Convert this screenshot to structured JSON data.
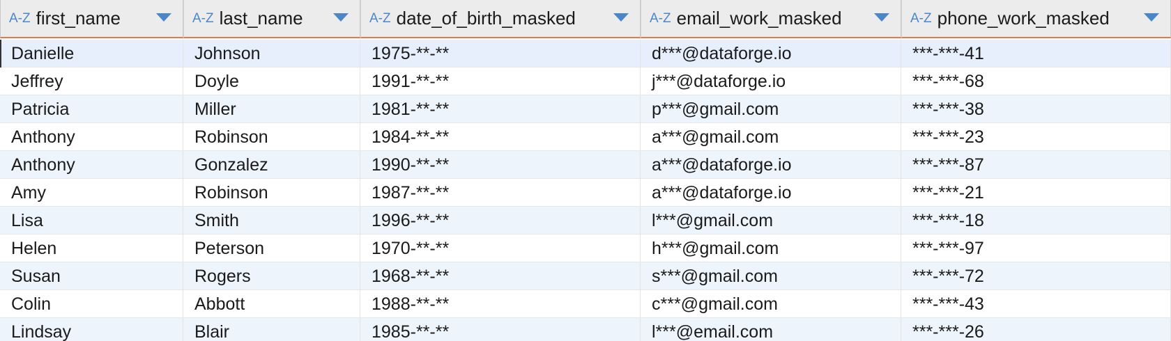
{
  "table": {
    "columns": [
      {
        "type_icon": "A-Z",
        "label": "first_name"
      },
      {
        "type_icon": "A-Z",
        "label": "last_name"
      },
      {
        "type_icon": "A-Z",
        "label": "date_of_birth_masked"
      },
      {
        "type_icon": "A-Z",
        "label": "email_work_masked"
      },
      {
        "type_icon": "A-Z",
        "label": "phone_work_masked"
      }
    ],
    "rows": [
      [
        "Danielle",
        "Johnson",
        "1975-**-**",
        "d***@dataforge.io",
        "***-***-41"
      ],
      [
        "Jeffrey",
        "Doyle",
        "1991-**-**",
        "j***@dataforge.io",
        "***-***-68"
      ],
      [
        "Patricia",
        "Miller",
        "1981-**-**",
        "p***@gmail.com",
        "***-***-38"
      ],
      [
        "Anthony",
        "Robinson",
        "1984-**-**",
        "a***@gmail.com",
        "***-***-23"
      ],
      [
        "Anthony",
        "Gonzalez",
        "1990-**-**",
        "a***@dataforge.io",
        "***-***-87"
      ],
      [
        "Amy",
        "Robinson",
        "1987-**-**",
        "a***@dataforge.io",
        "***-***-21"
      ],
      [
        "Lisa",
        "Smith",
        "1996-**-**",
        "l***@gmail.com",
        "***-***-18"
      ],
      [
        "Helen",
        "Peterson",
        "1970-**-**",
        "h***@gmail.com",
        "***-***-97"
      ],
      [
        "Susan",
        "Rogers",
        "1968-**-**",
        "s***@gmail.com",
        "***-***-72"
      ],
      [
        "Colin",
        "Abbott",
        "1988-**-**",
        "c***@gmail.com",
        "***-***-43"
      ],
      [
        "Lindsay",
        "Blair",
        "1985-**-**",
        "l***@email.com",
        "***-***-26"
      ]
    ],
    "selected_row": 0
  },
  "colors": {
    "accent": "#4a86c8",
    "header_bg": "#ececec",
    "header_underline": "#e07a4a",
    "row_alt": "#eef4fc",
    "row_selected": "#e6effb"
  },
  "icons": {
    "column_type": "text-type-icon",
    "sort": "chevron-down-icon"
  }
}
